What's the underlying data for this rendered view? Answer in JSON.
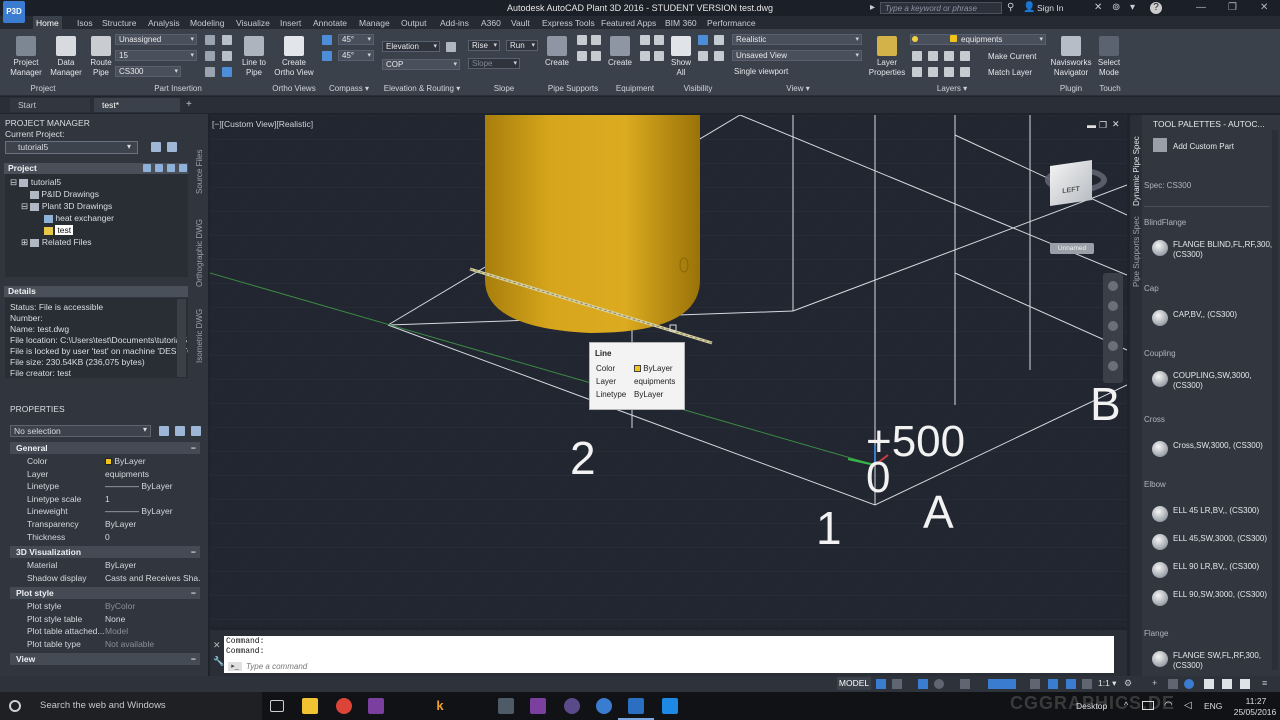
{
  "app": {
    "icon_label": "P3D",
    "title": "Autodesk AutoCAD Plant 3D 2016 - STUDENT VERSION   test.dwg",
    "search_placeholder": "Type a keyword or phrase",
    "sign_in": "Sign In"
  },
  "ribbon_tabs": [
    "Home",
    "Isos",
    "Structure",
    "Analysis",
    "Modeling",
    "Visualize",
    "Insert",
    "Annotate",
    "Manage",
    "Output",
    "Add-ins",
    "A360",
    "Vault",
    "Express Tools",
    "Featured Apps",
    "BIM 360",
    "Performance"
  ],
  "ribbon": {
    "project_manager": "Project\nManager",
    "data_manager": "Data\nManager",
    "route_pipe": "Route\nPipe",
    "line_to_pipe": "Line to\nPipe",
    "create_ortho_view": "Create\nOrtho View",
    "pipe_insertion_sel1": "Unassigned",
    "pipe_insertion_sel2": "15",
    "pipe_insertion_sel3": "CS300",
    "compass_val1": "45°",
    "compass_val2": "45°",
    "elevation": "Elevation",
    "cop": "COP",
    "rise": "Rise",
    "run": "Run",
    "slope": "Slope",
    "pipe_supports_create": "Create",
    "equipment_create": "Create",
    "show_all": "Show\nAll",
    "visual_style": "Realistic",
    "named_view": "Unsaved View",
    "single_viewport": "Single viewport",
    "layer_properties": "Layer\nProperties",
    "layer_name": "equipments",
    "make_current": "Make Current",
    "match_layer": "Match Layer",
    "navisworks": "Navisworks\nNavigator",
    "select_mode": "Select\nMode",
    "panels": {
      "project": "Project",
      "part_insertion": "Part Insertion",
      "ortho_views": "Ortho Views",
      "compass": "Compass ▾",
      "elevation_routing": "Elevation & Routing ▾",
      "slope": "Slope",
      "pipe_supports": "Pipe Supports",
      "equipment": "Equipment",
      "visibility": "Visibility",
      "view": "View ▾",
      "layers": "Layers ▾",
      "plugin": "Plugin",
      "touch": "Touch"
    }
  },
  "doc_tabs": [
    "Start",
    "test*"
  ],
  "project_manager": {
    "title": "PROJECT MANAGER",
    "current_project_label": "Current Project:",
    "current_project": "tutorial5",
    "project_header": "Project",
    "tree": [
      "tutorial5",
      "P&ID Drawings",
      "Plant 3D Drawings",
      "heat exchanger",
      "test",
      "Related Files"
    ],
    "side_tabs": [
      "Source Files",
      "Orthographic DWG",
      "Isometric DWG"
    ]
  },
  "details": {
    "header": "Details",
    "lines": [
      "Status: File is accessible",
      "Number:",
      "Name: test.dwg",
      "File location: C:\\Users\\test\\Documents\\tutorial5",
      "File is locked by user 'test' on machine 'DESKTOP'",
      "File size: 230.54KB (236,075 bytes)",
      "File creator: test"
    ]
  },
  "properties": {
    "title": "PROPERTIES",
    "selection": "No selection",
    "groups": [
      {
        "name": "General",
        "rows": [
          [
            "Color",
            "ByLayer"
          ],
          [
            "Layer",
            "equipments"
          ],
          [
            "Linetype",
            "———— ByLayer"
          ],
          [
            "Linetype scale",
            "1"
          ],
          [
            "Lineweight",
            "———— ByLayer"
          ],
          [
            "Transparency",
            "ByLayer"
          ],
          [
            "Thickness",
            "0"
          ]
        ]
      },
      {
        "name": "3D Visualization",
        "rows": [
          [
            "Material",
            "ByLayer"
          ],
          [
            "Shadow display",
            "Casts and Receives Sha..."
          ]
        ]
      },
      {
        "name": "Plot style",
        "rows": [
          [
            "Plot style",
            "ByColor"
          ],
          [
            "Plot style table",
            "None"
          ],
          [
            "Plot table attached...",
            "Model"
          ],
          [
            "Plot table type",
            "Not available"
          ]
        ]
      },
      {
        "name": "View",
        "rows": []
      }
    ]
  },
  "viewport": {
    "label": "[−][Custom View][Realistic]",
    "texts": {
      "n2": "2",
      "n1": "1",
      "plus500": "+500",
      "zero": "0",
      "A": "A",
      "B": "B"
    },
    "viewcube_face": "LEFT",
    "unnamed": "Unnamed"
  },
  "tooltip": {
    "title": "Line",
    "rows": [
      [
        "Color",
        "ByLayer"
      ],
      [
        "Layer",
        "equipments"
      ],
      [
        "Linetype",
        "ByLayer"
      ]
    ]
  },
  "command": {
    "lines": [
      "Command:",
      "Command:"
    ],
    "placeholder": "Type a command"
  },
  "tool_palettes": {
    "title": "TOOL PALETTES - AUTOC...",
    "side_tabs": [
      "Dynamic Pipe Spec",
      "Pipe Supports Spec"
    ],
    "add_custom": "Add Custom Part",
    "spec": "Spec: CS300",
    "sections": [
      {
        "header": "BlindFlange",
        "items": [
          "FLANGE BLIND,FL,RF,300, (CS300)"
        ]
      },
      {
        "header": "Cap",
        "items": [
          "CAP,BV,, (CS300)"
        ]
      },
      {
        "header": "Coupling",
        "items": [
          "COUPLING,SW,3000, (CS300)"
        ]
      },
      {
        "header": "Cross",
        "items": [
          "Cross,SW,3000, (CS300)"
        ]
      },
      {
        "header": "Elbow",
        "items": [
          "ELL 45 LR,BV,, (CS300)",
          "ELL 45,SW,3000, (CS300)",
          "ELL 90 LR,BV,, (CS300)",
          "ELL 90,SW,3000, (CS300)"
        ]
      },
      {
        "header": "Flange",
        "items": [
          "FLANGE SW,FL,RF,300, (CS300)"
        ]
      }
    ]
  },
  "statusbar": {
    "model": "MODEL",
    "scale": "1:1 ▾"
  },
  "taskbar": {
    "search": "Search the web and Windows",
    "desktop": "Desktop",
    "lang": "ENG",
    "time": "11:27",
    "date": "25/05/2016",
    "watermark": "CGGRAPHICS.DE"
  },
  "colors": {
    "accent": "#3a7ccf",
    "vessel": "#d4a017",
    "pipe": "#d8d1a0",
    "axis_green": "#38b84a",
    "axis_red": "#d23c3c",
    "bg_view": "#212630"
  }
}
